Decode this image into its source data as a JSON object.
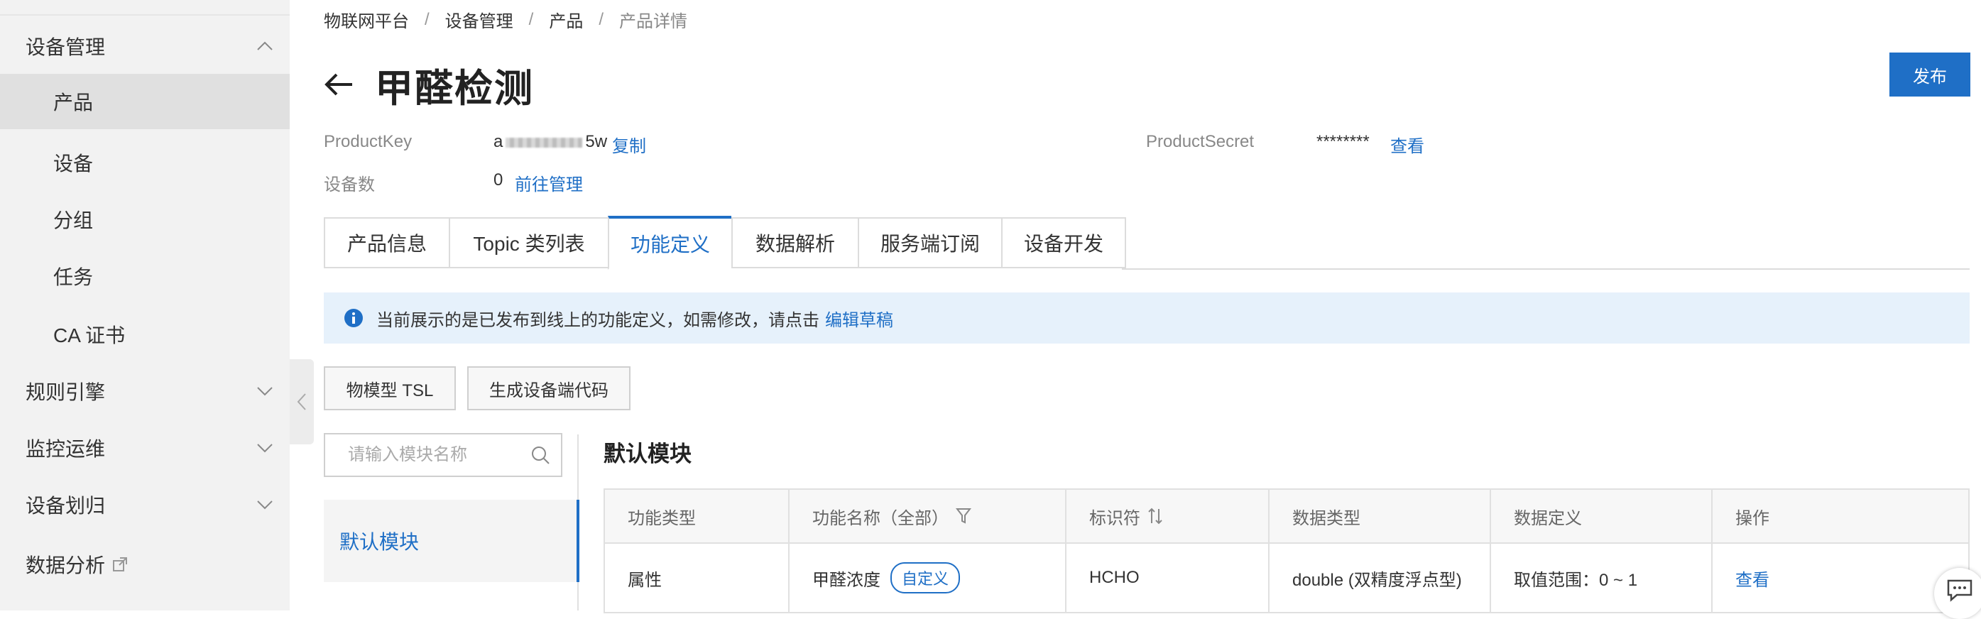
{
  "sidebar": {
    "groups": [
      {
        "label": "设备管理",
        "expanded": true
      },
      {
        "label": "规则引擎",
        "expanded": false
      },
      {
        "label": "监控运维",
        "expanded": false
      },
      {
        "label": "设备划归",
        "expanded": false
      },
      {
        "label": "数据分析",
        "external": true
      }
    ],
    "items": [
      {
        "label": "产品",
        "active": true
      },
      {
        "label": "设备"
      },
      {
        "label": "分组"
      },
      {
        "label": "任务"
      },
      {
        "label": "CA 证书"
      }
    ]
  },
  "breadcrumb": [
    "物联网平台",
    "设备管理",
    "产品",
    "产品详情"
  ],
  "breadcrumb_sep": "/",
  "page": {
    "title": "甲醛检测",
    "publish_label": "发布"
  },
  "meta": {
    "product_key_label": "ProductKey",
    "product_key_prefix": "a",
    "product_key_suffix": "5w",
    "copy_label": "复制",
    "product_secret_label": "ProductSecret",
    "product_secret_value": "********",
    "view_label": "查看",
    "device_count_label": "设备数",
    "device_count_value": "0",
    "manage_label": "前往管理"
  },
  "tabs": [
    {
      "label": "产品信息"
    },
    {
      "label": "Topic 类列表"
    },
    {
      "label": "功能定义",
      "active": true
    },
    {
      "label": "数据解析"
    },
    {
      "label": "服务端订阅"
    },
    {
      "label": "设备开发"
    }
  ],
  "banner": {
    "text": "当前展示的是已发布到线上的功能定义，如需修改，请点击",
    "link": "编辑草稿"
  },
  "actions": {
    "tsl_label": "物模型 TSL",
    "gen_code_label": "生成设备端代码"
  },
  "module_search": {
    "placeholder": "请输入模块名称"
  },
  "modules": [
    {
      "label": "默认模块",
      "active": true
    }
  ],
  "module_title": "默认模块",
  "table": {
    "headers": [
      "功能类型",
      "功能名称（全部）",
      "标识符",
      "数据类型",
      "数据定义",
      "操作"
    ],
    "rows": [
      {
        "type": "属性",
        "name": "甲醛浓度",
        "tag": "自定义",
        "identifier": "HCHO",
        "data_type": "double (双精度浮点型)",
        "definition": "取值范围：0 ~ 1",
        "action": "查看"
      }
    ]
  },
  "colors": {
    "accent": "#1f6fc6",
    "banner_bg": "#e6f1fb",
    "sidebar_bg": "#f2f2f2"
  }
}
